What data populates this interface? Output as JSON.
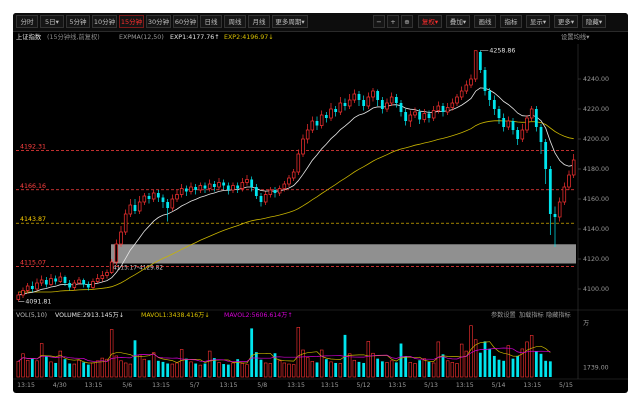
{
  "toolbar": {
    "tabs": [
      {
        "label": "分时"
      },
      {
        "label": "5日▾"
      },
      {
        "label": "5分钟"
      },
      {
        "label": "10分钟"
      },
      {
        "label": "15分钟"
      },
      {
        "label": "30分钟"
      },
      {
        "label": "60分钟"
      },
      {
        "label": "日线"
      },
      {
        "label": "周线"
      },
      {
        "label": "月线"
      },
      {
        "label": "更多周期▾"
      }
    ],
    "active_tab": "15分钟",
    "right": {
      "minus": "−",
      "plus": "+",
      "crosshair": "⊕",
      "fq": "复权▾",
      "overlay": "叠加▾",
      "draw": "画线",
      "indicator": "指标",
      "display": "显示▾",
      "more": "更多▾",
      "hide": "隐藏▾"
    }
  },
  "info": {
    "name": "上证指数",
    "period": "(15分钟线,前复权)",
    "expma": "EXPMA(12,50)",
    "exp1": "EXP1:4177.76↑",
    "exp2": "EXP2:4196.97↓",
    "settings": "设置均线▾"
  },
  "price_axis": [
    "4240.00",
    "4220.00",
    "4200.00",
    "4180.00",
    "4160.00",
    "4140.00",
    "4120.00",
    "4100.00"
  ],
  "h_lines": [
    {
      "label": "4192.31",
      "value": 4192.31,
      "style": "dash-red",
      "color": "#ff4040"
    },
    {
      "label": "4166.16",
      "value": 4166.16,
      "style": "dash-red",
      "color": "#ff4040"
    },
    {
      "label": "4143.87",
      "value": 4143.87,
      "style": "dash-yellow",
      "color": "#ffd000"
    },
    {
      "label": "4115.07",
      "value": 4115.07,
      "style": "dash-red",
      "color": "#ff4040"
    }
  ],
  "zone": {
    "from": 4117,
    "to": 4129.82,
    "label": "4115.17-4129.82"
  },
  "annotations": {
    "high": "4258.86",
    "low": "4091.81"
  },
  "volume": {
    "title": "VOL(5,10)",
    "vol": "VOLUME:2913.145万↓",
    "mavol1": "MAVOL1:3438.416万↓",
    "mavol2": "MAVOL2:5606.614万↑",
    "btns": [
      "参数设置",
      "加载指标",
      "隐藏指标"
    ],
    "axis": [
      "万",
      "1739.00"
    ]
  },
  "time_axis": [
    "13:15",
    "4/30",
    "13:15",
    "5/6",
    "13:15",
    "5/7",
    "13:15",
    "5/8",
    "13:15",
    "13:15",
    "5/12",
    "13:15",
    "5/13",
    "13:15",
    "5/14",
    "13:15",
    "5/15"
  ],
  "colors": {
    "up": "#ff3232",
    "down": "#00e5ee",
    "exp1": "#e6e6e6",
    "exp2": "#c8b400",
    "zone": "#a9a9a9",
    "mavol1": "#c8b400",
    "mavol2": "#d400d4"
  },
  "chart_data": {
    "type": "candlestick",
    "title": "上证指数",
    "ylim": [
      4088,
      4262
    ],
    "candles": [
      [
        4093,
        4096,
        4091.81,
        4098
      ],
      [
        4096,
        4099,
        4094,
        4101
      ],
      [
        4099,
        4102,
        4097,
        4104
      ],
      [
        4102,
        4100,
        4098,
        4105
      ],
      [
        4100,
        4104,
        4099,
        4107
      ],
      [
        4104,
        4106,
        4102,
        4109
      ],
      [
        4106,
        4103,
        4101,
        4108
      ],
      [
        4103,
        4107,
        4102,
        4110
      ],
      [
        4107,
        4105,
        4103,
        4109
      ],
      [
        4105,
        4108,
        4104,
        4111
      ],
      [
        4108,
        4104,
        4102,
        4109
      ],
      [
        4104,
        4101,
        4099,
        4106
      ],
      [
        4101,
        4104,
        4099,
        4106
      ],
      [
        4104,
        4106,
        4103,
        4108
      ],
      [
        4106,
        4103,
        4101,
        4107
      ],
      [
        4103,
        4101,
        4099,
        4105
      ],
      [
        4101,
        4105,
        4100,
        4107
      ],
      [
        4105,
        4107,
        4104,
        4110
      ],
      [
        4107,
        4109,
        4105,
        4112
      ],
      [
        4109,
        4111,
        4107,
        4113
      ],
      [
        4111,
        4118,
        4110,
        4120
      ],
      [
        4118,
        4130,
        4116,
        4133
      ],
      [
        4130,
        4138,
        4128,
        4142
      ],
      [
        4138,
        4150,
        4136,
        4153
      ],
      [
        4150,
        4156,
        4148,
        4160
      ],
      [
        4156,
        4152,
        4150,
        4160
      ],
      [
        4152,
        4158,
        4150,
        4162
      ],
      [
        4158,
        4162,
        4156,
        4164
      ],
      [
        4162,
        4160,
        4157,
        4164
      ],
      [
        4160,
        4164,
        4158,
        4166
      ],
      [
        4164,
        4161,
        4158,
        4166
      ],
      [
        4161,
        4158,
        4154,
        4163
      ],
      [
        4158,
        4154,
        4145,
        4160
      ],
      [
        4154,
        4160,
        4152,
        4163
      ],
      [
        4160,
        4163,
        4158,
        4166
      ],
      [
        4163,
        4167,
        4161,
        4170
      ],
      [
        4167,
        4165,
        4162,
        4169
      ],
      [
        4165,
        4168,
        4163,
        4171
      ],
      [
        4168,
        4166,
        4163,
        4170
      ],
      [
        4166,
        4169,
        4164,
        4171
      ],
      [
        4169,
        4167,
        4164,
        4171
      ],
      [
        4167,
        4170,
        4165,
        4173
      ],
      [
        4170,
        4168,
        4165,
        4172
      ],
      [
        4168,
        4171,
        4166,
        4174
      ],
      [
        4171,
        4169,
        4166,
        4173
      ],
      [
        4169,
        4166,
        4163,
        4171
      ],
      [
        4166,
        4169,
        4164,
        4171
      ],
      [
        4169,
        4167,
        4164,
        4171
      ],
      [
        4167,
        4171,
        4165,
        4174
      ],
      [
        4171,
        4173,
        4169,
        4176
      ],
      [
        4173,
        4168,
        4165,
        4175
      ],
      [
        4168,
        4162,
        4160,
        4170
      ],
      [
        4162,
        4158,
        4155,
        4164
      ],
      [
        4158,
        4163,
        4156,
        4165
      ],
      [
        4163,
        4166,
        4161,
        4168
      ],
      [
        4166,
        4164,
        4161,
        4168
      ],
      [
        4164,
        4167,
        4162,
        4169
      ],
      [
        4167,
        4170,
        4165,
        4172
      ],
      [
        4170,
        4174,
        4168,
        4176
      ],
      [
        4174,
        4178,
        4172,
        4180
      ],
      [
        4178,
        4190,
        4176,
        4193
      ],
      [
        4190,
        4200,
        4188,
        4203
      ],
      [
        4200,
        4206,
        4197,
        4210
      ],
      [
        4206,
        4212,
        4204,
        4215
      ],
      [
        4212,
        4209,
        4206,
        4215
      ],
      [
        4209,
        4216,
        4207,
        4219
      ],
      [
        4216,
        4214,
        4211,
        4218
      ],
      [
        4214,
        4220,
        4212,
        4224
      ],
      [
        4220,
        4218,
        4215,
        4222
      ],
      [
        4218,
        4224,
        4216,
        4228
      ],
      [
        4224,
        4222,
        4219,
        4227
      ],
      [
        4222,
        4226,
        4220,
        4230
      ],
      [
        4226,
        4230,
        4224,
        4233
      ],
      [
        4230,
        4226,
        4222,
        4232
      ],
      [
        4226,
        4222,
        4219,
        4229
      ],
      [
        4222,
        4228,
        4220,
        4231
      ],
      [
        4228,
        4232,
        4225,
        4234
      ],
      [
        4232,
        4226,
        4222,
        4233
      ],
      [
        4226,
        4220,
        4217,
        4228
      ],
      [
        4220,
        4224,
        4218,
        4227
      ],
      [
        4224,
        4228,
        4222,
        4231
      ],
      [
        4228,
        4224,
        4221,
        4230
      ],
      [
        4224,
        4218,
        4215,
        4226
      ],
      [
        4218,
        4212,
        4209,
        4220
      ],
      [
        4212,
        4216,
        4208,
        4219
      ],
      [
        4216,
        4218,
        4214,
        4221
      ],
      [
        4218,
        4213,
        4210,
        4220
      ],
      [
        4213,
        4217,
        4211,
        4220
      ],
      [
        4217,
        4214,
        4211,
        4219
      ],
      [
        4214,
        4219,
        4212,
        4222
      ],
      [
        4219,
        4222,
        4217,
        4225
      ],
      [
        4222,
        4218,
        4215,
        4224
      ],
      [
        4218,
        4221,
        4216,
        4224
      ],
      [
        4221,
        4224,
        4219,
        4227
      ],
      [
        4224,
        4228,
        4222,
        4230
      ],
      [
        4228,
        4232,
        4226,
        4235
      ],
      [
        4232,
        4236,
        4230,
        4239
      ],
      [
        4236,
        4240,
        4234,
        4243
      ],
      [
        4240,
        4258.86,
        4238,
        4258.86
      ],
      [
        4258,
        4246,
        4244,
        4259
      ],
      [
        4246,
        4232,
        4229,
        4248
      ],
      [
        4232,
        4226,
        4222,
        4234
      ],
      [
        4226,
        4220,
        4216,
        4229
      ],
      [
        4220,
        4214,
        4210,
        4222
      ],
      [
        4214,
        4208,
        4205,
        4217
      ],
      [
        4208,
        4212,
        4206,
        4215
      ],
      [
        4212,
        4206,
        4203,
        4214
      ],
      [
        4206,
        4200,
        4196,
        4208
      ],
      [
        4200,
        4206,
        4198,
        4210
      ],
      [
        4206,
        4214,
        4204,
        4216
      ],
      [
        4214,
        4220,
        4212,
        4222
      ],
      [
        4220,
        4208,
        4205,
        4222
      ],
      [
        4208,
        4198,
        4190,
        4210
      ],
      [
        4198,
        4180,
        4170,
        4200
      ],
      [
        4180,
        4150,
        4136,
        4182
      ],
      [
        4150,
        4148,
        4128,
        4155
      ],
      [
        4148,
        4158,
        4145,
        4161
      ],
      [
        4158,
        4168,
        4156,
        4171
      ],
      [
        4168,
        4176,
        4166,
        4179
      ],
      [
        4176,
        4186,
        4174,
        4190
      ]
    ],
    "volume": [
      2900,
      4300,
      3100,
      3500,
      3000,
      6200,
      3900,
      2800,
      2600,
      4800,
      3300,
      2500,
      2400,
      3100,
      2700,
      2300,
      2600,
      3000,
      3500,
      3300,
      8800,
      3900,
      3000,
      2600,
      2400,
      6800,
      4100,
      3300,
      3100,
      4500,
      3000,
      2800,
      2500,
      2400,
      2600,
      5100,
      3400,
      2800,
      2500,
      2200,
      2500,
      4800,
      3500,
      2700,
      2400,
      2300,
      2600,
      3300,
      2500,
      2300,
      9000,
      4600,
      3200,
      2600,
      2500,
      4400,
      3000,
      2600,
      2400,
      2300,
      9200,
      5000,
      3600,
      2900,
      2700,
      5000,
      3300,
      2800,
      2600,
      2500,
      7800,
      4300,
      3100,
      2800,
      2600,
      6600,
      4400,
      3400,
      2900,
      2700,
      3000,
      2700,
      6200,
      3800,
      2700,
      2500,
      3100,
      3400,
      2800,
      2600,
      6500,
      4200,
      3000,
      2700,
      2500,
      6100,
      4800,
      9500,
      6900,
      4500,
      6600,
      5200,
      3900,
      3200,
      3000,
      5800,
      3400,
      3900,
      5200,
      6500,
      7700,
      4800,
      4300,
      3000,
      2900
    ]
  }
}
